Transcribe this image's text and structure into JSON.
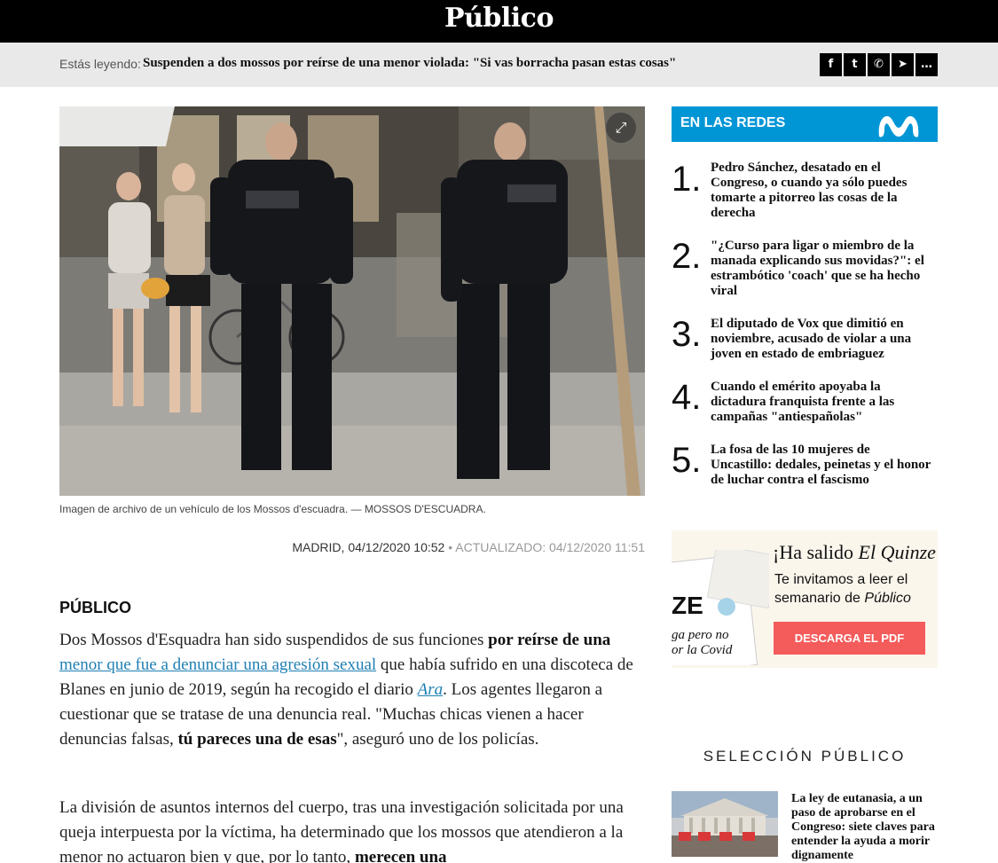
{
  "header": {
    "logo_text": "Público"
  },
  "reading_bar": {
    "label": "Estás leyendo:",
    "title": "Suspenden a dos mossos por reírse de una menor violada: \"Si vas borracha pasan estas cosas\"",
    "share_icons": [
      {
        "name": "facebook-icon",
        "glyph": "f"
      },
      {
        "name": "twitter-icon",
        "glyph": "t"
      },
      {
        "name": "whatsapp-icon",
        "glyph": "✆"
      },
      {
        "name": "telegram-icon",
        "glyph": "➤"
      },
      {
        "name": "comments-icon",
        "glyph": "…"
      }
    ]
  },
  "article": {
    "image_caption": "Imagen de archivo de un vehículo de los Mossos d'escuadra. — MOSSOS D'ESCUADRA.",
    "location": "MADRID,",
    "date": "04/12/2020 10:52",
    "separator": "•",
    "updated": "ACTUALIZADO: 04/12/2020 11:51",
    "author": "PÚBLICO",
    "p1": {
      "t1": "Dos Mossos d'Esquadra han sido suspendidos de sus funciones ",
      "b1": "por reírse de una",
      "t2": " ",
      "link1": "menor que fue a denunciar una agresión sexual",
      "t3": " que había sufrido en una discoteca de Blanes en junio de 2019, según ha recogido el diario ",
      "link2": "Ara",
      "t4": ". Los agentes llegaron a cuestionar que se tratase de una denuncia real. \"Muchas chicas vienen a hacer denuncias falsas, ",
      "b2": "tú pareces una de esas",
      "t5": "\", aseguró uno de los policías."
    },
    "p2": {
      "t1": "La división de asuntos internos del cuerpo, tras una investigación solicitada por una queja interpuesta por la víctima, ha determinado que los mossos que atendieron a la menor no actuaron bien y que, por lo tanto, ",
      "b1": "merecen una"
    }
  },
  "sidebar": {
    "redes_title": "EN LAS REDES",
    "ranking": [
      {
        "num": "1.",
        "text": "Pedro Sánchez, desatado en el Congreso, o cuando ya sólo puedes tomarte a pitorreo las cosas de la derecha"
      },
      {
        "num": "2.",
        "text": "\"¿Curso para ligar o miembro de la manada explicando sus movidas?\": el estrambótico 'coach' que se ha hecho viral"
      },
      {
        "num": "3.",
        "text": "El diputado de Vox que dimitió en noviembre, acusado de violar a una joven en estado de embriaguez"
      },
      {
        "num": "4.",
        "text": "Cuando el emérito apoyaba la dictadura franquista frente a las campañas \"antiespañolas\""
      },
      {
        "num": "5.",
        "text": "La fosa de las 10 mujeres de Uncastillo: dedales, peinetas y el honor de luchar contra el fascismo"
      }
    ],
    "promo": {
      "title_pre": "¡Ha salido ",
      "title_em": "El Quinze",
      "title_post": "!",
      "sub_pre": "Te invitamos a leer el semanario de ",
      "sub_em": "Público",
      "button": "DESCARGA EL PDF",
      "mag_masthead": "ZE",
      "mag_headline": "ga pero no\nor la Covid"
    },
    "seleccion_title": "SELECCIÓN PÚBLICO",
    "seleccion_item": "La ley de eutanasia, a un paso de aprobarse en el Congreso: siete claves para entender la ayuda a morir dignamente"
  },
  "colors": {
    "accent_blue": "#0096d6",
    "link": "#1e7fb3",
    "promo_button": "#f45b5b",
    "topbar": "#000000"
  }
}
